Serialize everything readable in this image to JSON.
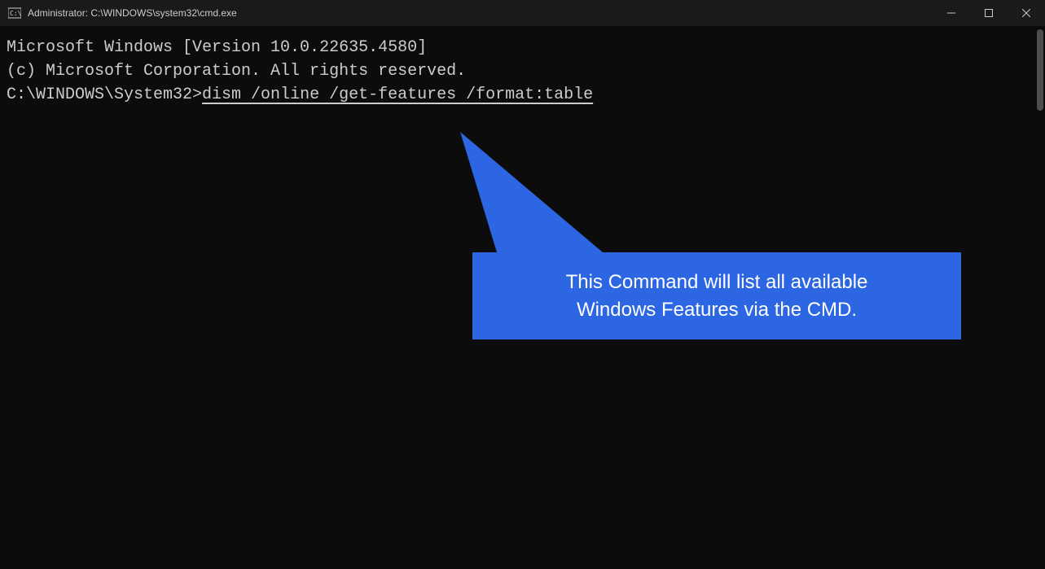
{
  "titlebar": {
    "title": "Administrator: C:\\WINDOWS\\system32\\cmd.exe"
  },
  "terminal": {
    "line1": "Microsoft Windows [Version 10.0.22635.4580]",
    "line2": "(c) Microsoft Corporation. All rights reserved.",
    "blank": "",
    "prompt": "C:\\WINDOWS\\System32>",
    "command": "dism /online /get-features /format:table"
  },
  "callout": {
    "text_line1": "This Command will list all available",
    "text_line2": "Windows Features via the CMD."
  }
}
